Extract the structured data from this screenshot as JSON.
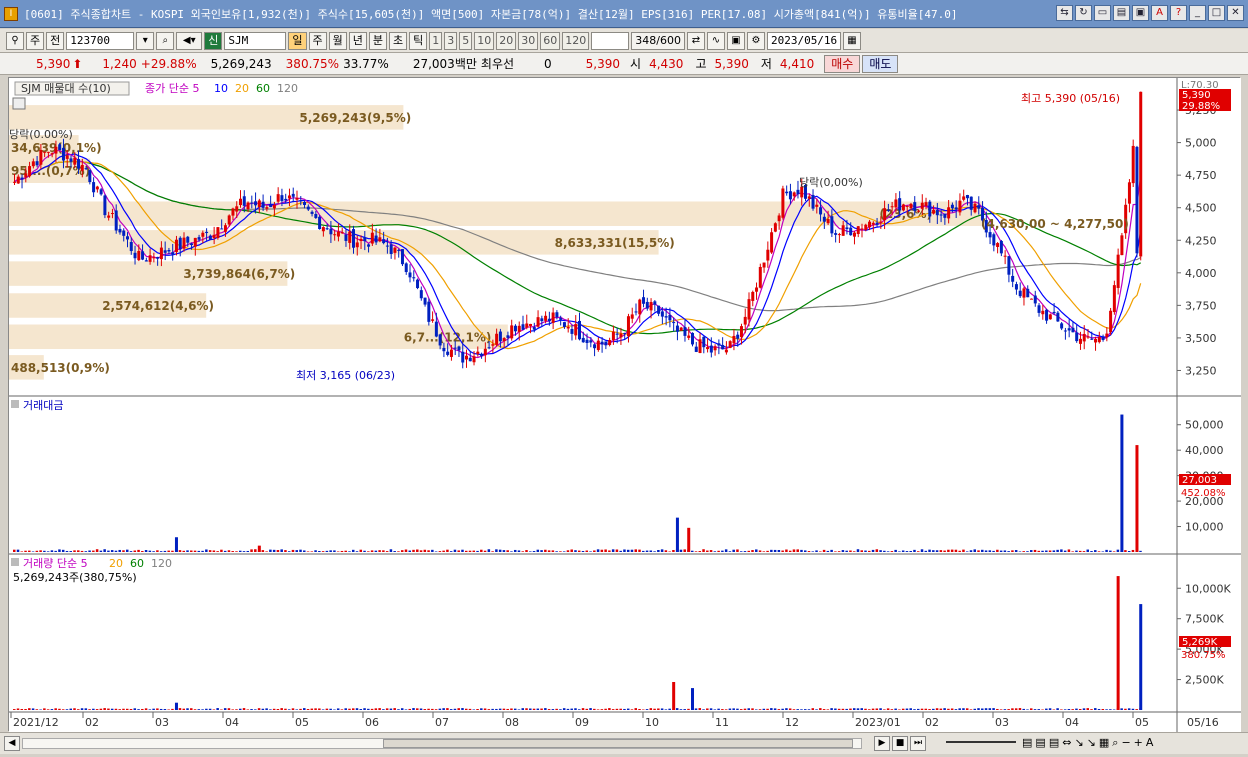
{
  "window": {
    "title": "[0601] 주식종합차트 - KOSPI 외국인보유[1,932(천)] 주식수[15,605(천)] 액면[500] 자본금[78(억)] 결산[12월] EPS[316] PER[17.08] 시가총액[841(억)] 유통비율[47.0]"
  },
  "toolbar": {
    "market": "주",
    "prev": "전",
    "code": "123700",
    "badge": "신",
    "name": "SJM",
    "periods": [
      "일",
      "주",
      "월",
      "년",
      "분",
      "초",
      "틱"
    ],
    "active_period": "일",
    "counts": [
      "1",
      "3",
      "5",
      "10",
      "20",
      "30",
      "60",
      "120"
    ],
    "count_display": "348/600",
    "date": "2023/05/16"
  },
  "quote": {
    "price": "5,390",
    "change": "1,240",
    "change_pct": "+29.88%",
    "volume": "5,269,243",
    "vol_ratio": "380.75%",
    "turnover_ratio": "33.77%",
    "amount": "27,003백만",
    "priority_label": "최우선",
    "priority_value": "0",
    "ask": "5,390",
    "open_label": "시",
    "open": "4,430",
    "high_label": "고",
    "high": "5,390",
    "low_label": "저",
    "low": "4,410",
    "buy_label": "매수",
    "sell_label": "매도"
  },
  "panels": {
    "price_legend": [
      "SJM 매물대 수(10)",
      "종가 단순 5",
      "10",
      "20",
      "60",
      "120"
    ],
    "amount_title": "거래대금",
    "volume_legend": [
      "거래량 단순 5",
      "20",
      "60",
      "120"
    ],
    "volume_sub": "5,269,243주(380,75%)"
  },
  "annotations": {
    "high": "최고 5,390 (05/16)",
    "low": "최저 3,165 (06/23)",
    "price_tag_top": "5,390",
    "price_tag_pct": "29.88%",
    "price_corner": "L:70.30",
    "amount_tag": "27,003",
    "amount_tag_pct": "452.08%",
    "volume_tag": "5,269K",
    "volume_tag_pct": "380.75%",
    "down_label_1": "당락(0.00%)",
    "down_label_2": "당락(0,00%)",
    "range_note": "(4,630,00 ~ 4,277,50)"
  },
  "volume_profile": [
    {
      "label": "5,269,243(9,5%)",
      "price": 5190,
      "width": 0.34
    },
    {
      "label": "34,639(0,1%)",
      "price": 4960,
      "width": 0.06
    },
    {
      "label": "95,...(0,7%)",
      "price": 4780,
      "width": 0.07
    },
    {
      "label": "(23,6%)",
      "price": 4450,
      "width": 0.84
    },
    {
      "label": "8,633,331(15,5%)",
      "price": 4230,
      "width": 0.56
    },
    {
      "label": "3,739,864(6,7%)",
      "price": 3990,
      "width": 0.24
    },
    {
      "label": "2,574,612(4,6%)",
      "price": 3745,
      "width": 0.17
    },
    {
      "label": "6,7...(12,1%)",
      "price": 3505,
      "width": 0.43
    },
    {
      "label": "488,513(0,9%)",
      "price": 3270,
      "width": 0.03
    }
  ],
  "chart_data": {
    "type": "candlestick",
    "x_ticks": [
      "2021/12",
      "02",
      "03",
      "04",
      "05",
      "06",
      "07",
      "08",
      "09",
      "10",
      "11",
      "12",
      "2023/01",
      "02",
      "03",
      "04",
      "05",
      "05/16"
    ],
    "price_axis": {
      "ticks": [
        3250,
        3500,
        3750,
        4000,
        4250,
        4500,
        4750,
        5000,
        5250
      ],
      "range": [
        3100,
        5450
      ]
    },
    "amount_axis": {
      "ticks": [
        "10,000",
        "20,000",
        "30,000",
        "40,000",
        "50,000"
      ],
      "range": [
        0,
        55000
      ]
    },
    "volume_axis": {
      "ticks": [
        "2,500K",
        "5,000K",
        "7,500K",
        "10,000K"
      ],
      "range": [
        0,
        11500
      ]
    },
    "close_path": [
      4700,
      4850,
      4950,
      4900,
      4800,
      4500,
      4300,
      4100,
      4150,
      4200,
      4250,
      4300,
      4450,
      4550,
      4500,
      4600,
      4500,
      4400,
      4300,
      4250,
      4250,
      4200,
      4050,
      3700,
      3450,
      3350,
      3400,
      3500,
      3600,
      3620,
      3650,
      3600,
      3500,
      3450,
      3550,
      3750,
      3700,
      3550,
      3450,
      3400,
      3420,
      3700,
      4150,
      4600,
      4650,
      4450,
      4300,
      4350,
      4400,
      4500,
      4550,
      4500,
      4450,
      4550,
      4450,
      4200,
      3900,
      3750,
      3650,
      3550,
      3480,
      3500,
      4300,
      5390
    ],
    "amount_spikes": [
      {
        "i": 9,
        "v": 5800
      },
      {
        "i": 14,
        "v": 2500
      },
      {
        "i": 37,
        "v": 13500
      },
      {
        "i": 38,
        "v": 9500
      },
      {
        "i": 62,
        "v": 54000
      },
      {
        "i": 63,
        "v": 42000
      }
    ],
    "volume_spikes": [
      {
        "i": 9,
        "v": 600
      },
      {
        "i": 37,
        "v": 2300
      },
      {
        "i": 38,
        "v": 1800
      },
      {
        "i": 62,
        "v": 11000
      },
      {
        "i": 63,
        "v": 8700
      }
    ],
    "colors": {
      "up": "#e00000",
      "down": "#0020c0",
      "ma5": "#c000c0",
      "ma10": "#0000ff",
      "ma20": "#f0a000",
      "ma60": "#008000",
      "ma120": "#808080",
      "profile": "#f5e6cf"
    }
  },
  "bottombar": {
    "date_display": "05/16"
  }
}
